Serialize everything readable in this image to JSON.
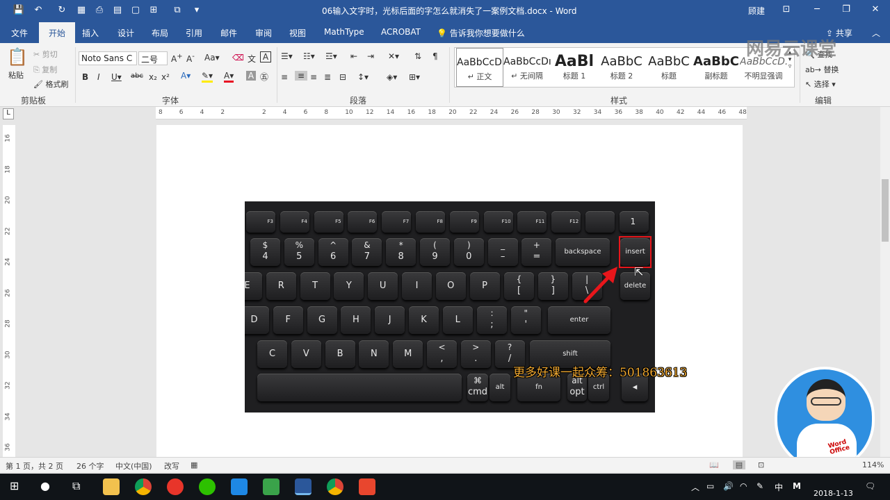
{
  "window": {
    "title": "06输入文字时，光标后面的字怎么就消失了一案例文档.docx - Word",
    "user": "顾建"
  },
  "tabs": [
    "文件",
    "开始",
    "插入",
    "设计",
    "布局",
    "引用",
    "邮件",
    "审阅",
    "视图",
    "MathType",
    "ACROBAT"
  ],
  "active_tab": "开始",
  "tell_me": "告诉我你想要做什么",
  "share": "共享",
  "clipboard": {
    "paste": "粘贴",
    "cut": "剪切",
    "copy": "复制",
    "painter": "格式刷",
    "group": "剪贴板"
  },
  "font": {
    "name": "Noto Sans C",
    "size": "二号",
    "group": "字体"
  },
  "paragraph": {
    "group": "段落"
  },
  "styles": {
    "group": "样式",
    "items": [
      {
        "preview": "AaBbCcDı",
        "name": "↵ 正文"
      },
      {
        "preview": "AaBbCcDı",
        "name": "↵ 无间隔"
      },
      {
        "preview": "AaBl",
        "name": "标题 1"
      },
      {
        "preview": "AaBbC",
        "name": "标题 2"
      },
      {
        "preview": "AaBbC",
        "name": "标题"
      },
      {
        "preview": "AaBbC",
        "name": "副标题"
      },
      {
        "preview": "AaBbCcD.",
        "name": "不明显强调"
      }
    ]
  },
  "editing": {
    "find": "查找",
    "replace": "替换",
    "select": "选择",
    "group": "编辑"
  },
  "ruler_ticks": [
    "8",
    "6",
    "4",
    "2",
    "",
    "2",
    "4",
    "6",
    "8",
    "10",
    "12",
    "14",
    "16",
    "18",
    "20",
    "22",
    "24",
    "26",
    "28",
    "30",
    "32",
    "34",
    "36",
    "38",
    "40",
    "42",
    "44",
    "46",
    "48"
  ],
  "vruler_ticks": [
    "16",
    "18",
    "20",
    "22",
    "24",
    "26",
    "28",
    "30",
    "32",
    "34",
    "36"
  ],
  "keyboard": {
    "fn_row": [
      "F3",
      "F4",
      "F5",
      "F6",
      "F7",
      "F8",
      "F9",
      "F10",
      "F11",
      "F12",
      "",
      "1"
    ],
    "num_row": [
      [
        "$",
        "4"
      ],
      [
        "%",
        "5"
      ],
      [
        "^",
        "6"
      ],
      [
        "&",
        "7"
      ],
      [
        "*",
        "8"
      ],
      [
        "(",
        "9"
      ],
      [
        ")",
        "0"
      ],
      [
        "_",
        "–"
      ],
      [
        "+",
        "="
      ]
    ],
    "backspace": "backspace",
    "insert": "insert",
    "delete": "delete",
    "row_q": [
      "E",
      "R",
      "T",
      "Y",
      "U",
      "I",
      "O",
      "P"
    ],
    "row_q_sym": [
      [
        "{",
        "["
      ],
      [
        "}",
        "]"
      ],
      [
        "|",
        "\\"
      ]
    ],
    "row_a": [
      "D",
      "F",
      "G",
      "H",
      "J",
      "K",
      "L"
    ],
    "row_a_sym": [
      [
        ":",
        ";"
      ],
      [
        "\"",
        "'"
      ]
    ],
    "enter": "enter",
    "row_z": [
      "C",
      "V",
      "B",
      "N",
      "M"
    ],
    "row_z_sym": [
      [
        "<",
        ","
      ],
      [
        ">",
        "."
      ],
      [
        "?",
        "/"
      ]
    ],
    "shift": "shift",
    "bottom": [
      [
        "⌘",
        "cmd"
      ],
      [
        "",
        "alt"
      ],
      [
        "",
        "fn"
      ],
      [
        "alt",
        "opt"
      ],
      [
        "",
        "ctrl"
      ]
    ]
  },
  "promo_text": "更多好课一起众筹：501863613",
  "watermark": "网易云课堂",
  "avatar_label": "Word Office",
  "status": {
    "page": "第 1 页，共 2 页",
    "words": "26 个字",
    "lang": "中文(中国)",
    "track": "改写",
    "zoom": "114%"
  },
  "taskbar": {
    "date": "2018-1-13",
    "ime": "中",
    "m": "M"
  }
}
